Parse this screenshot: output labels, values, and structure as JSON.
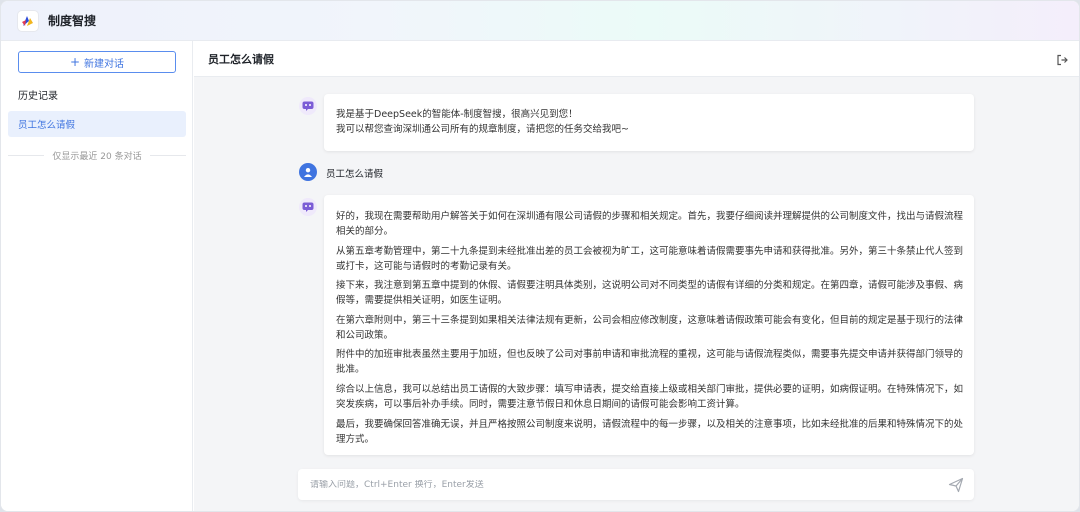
{
  "app": {
    "title": "制度智搜"
  },
  "sidebar": {
    "new_chat_label": "新建对话",
    "history_title": "历史记录",
    "history_items": [
      {
        "label": "员工怎么请假"
      }
    ],
    "history_note": "仅显示最近 20 条对话"
  },
  "chat": {
    "title": "员工怎么请假",
    "messages": [
      {
        "role": "bot",
        "lines": [
          "我是基于DeepSeek的智能体-制度智搜，很高兴见到您！",
          "我可以帮您查询深圳通公司所有的规章制度，请把您的任务交给我吧~"
        ]
      },
      {
        "role": "user",
        "text": "员工怎么请假"
      },
      {
        "role": "bot",
        "paragraphs": [
          "好的，我现在需要帮助用户解答关于如何在深圳通有限公司请假的步骤和相关规定。首先，我要仔细阅读并理解提供的公司制度文件，找出与请假流程相关的部分。",
          "从第五章考勤管理中，第二十九条提到未经批准出差的员工会被视为旷工，这可能意味着请假需要事先申请和获得批准。另外，第三十条禁止代人签到或打卡，这可能与请假时的考勤记录有关。",
          "接下来，我注意到第五章中提到的休假、请假要注明具体类别，这说明公司对不同类型的请假有详细的分类和规定。在第四章，请假可能涉及事假、病假等，需要提供相关证明，如医生证明。",
          "在第六章附则中，第三十三条提到如果相关法律法规有更新，公司会相应修改制度，这意味着请假政策可能会有变化，但目前的规定是基于现行的法律和公司政策。",
          "附件中的加班审批表虽然主要用于加班，但也反映了公司对事前申请和审批流程的重视，这可能与请假流程类似，需要事先提交申请并获得部门领导的批准。",
          "综合以上信息，我可以总结出员工请假的大致步骤：填写申请表，提交给直接上级或相关部门审批，提供必要的证明，如病假证明。在特殊情况下，如突发疾病，可以事后补办手续。同时，需要注意节假日和休息日期间的请假可能会影响工资计算。",
          "最后，我要确保回答准确无误，并且严格按照公司制度来说明，请假流程中的每一步骤，以及相关的注意事项，比如未经批准的后果和特殊情况下的处理方式。"
        ]
      }
    ]
  },
  "input": {
    "placeholder": "请输入问题，Ctrl+Enter 换行，Enter发送"
  },
  "colors": {
    "accent": "#3f74e0",
    "bot_avatar": "#7b5cd6"
  }
}
